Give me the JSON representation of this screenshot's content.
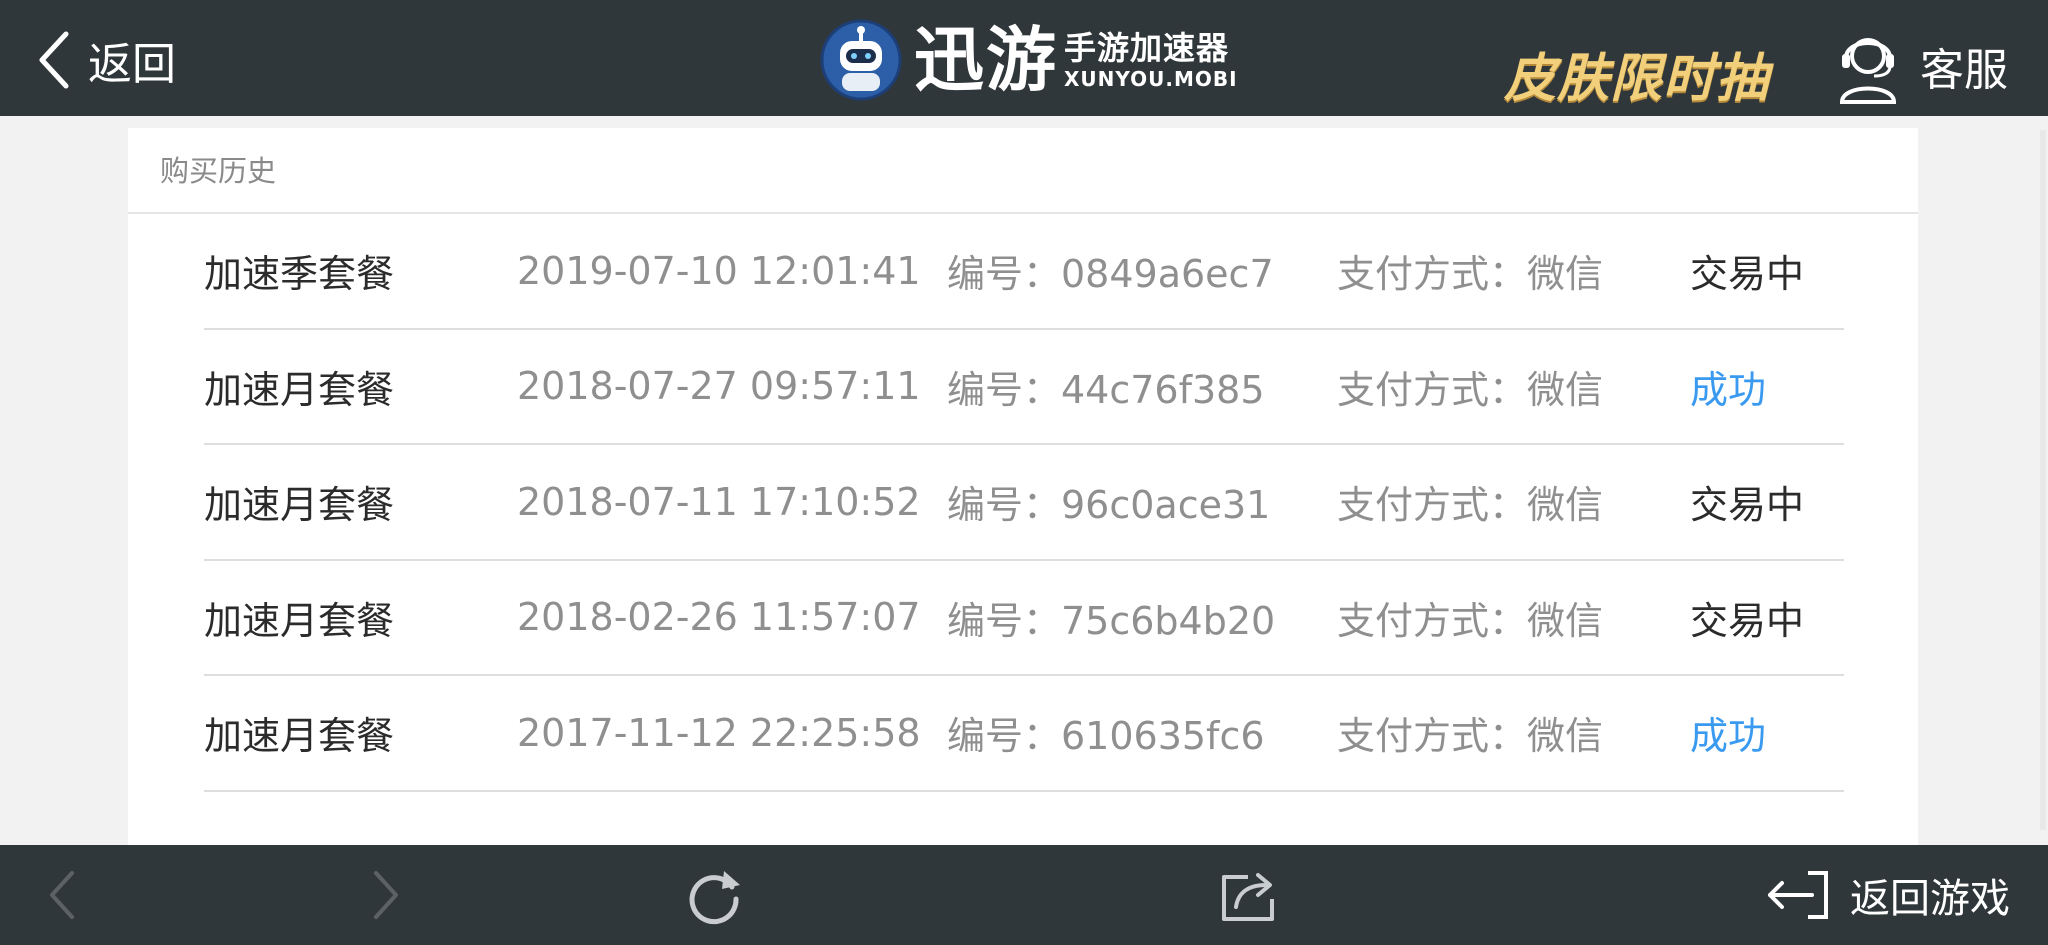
{
  "header": {
    "back_label": "返回",
    "brand_text": "迅游",
    "brand_sub_cn": "手游加速器",
    "brand_sub_en": "XUNYOU.MOBI",
    "promo_text": "皮肤限时抽",
    "support_label": "客服"
  },
  "section": {
    "title": "购买历史"
  },
  "orders": [
    {
      "plan": "加速季套餐",
      "time": "2019-07-10 12:01:41",
      "id": "编号：0849a6ec7",
      "pay": "支付方式：微信",
      "status": "交易中",
      "status_type": "pending"
    },
    {
      "plan": "加速月套餐",
      "time": "2018-07-27 09:57:11",
      "id": "编号：44c76f385",
      "pay": "支付方式：微信",
      "status": "成功",
      "status_type": "success"
    },
    {
      "plan": "加速月套餐",
      "time": "2018-07-11 17:10:52",
      "id": "编号：96c0ace31",
      "pay": "支付方式：微信",
      "status": "交易中",
      "status_type": "pending"
    },
    {
      "plan": "加速月套餐",
      "time": "2018-02-26 11:57:07",
      "id": "编号：75c6b4b20",
      "pay": "支付方式：微信",
      "status": "交易中",
      "status_type": "pending"
    },
    {
      "plan": "加速月套餐",
      "time": "2017-11-12 22:25:58",
      "id": "编号：610635fc6",
      "pay": "支付方式：微信",
      "status": "成功",
      "status_type": "success"
    }
  ],
  "bottom": {
    "return_game_label": "返回游戏",
    "icons": [
      "back-arrow-icon",
      "forward-arrow-icon",
      "refresh-icon",
      "share-icon",
      "exit-icon"
    ]
  },
  "colors": {
    "bar_bg": "#30373a",
    "success": "#3a9af0",
    "promo": "#f2cf7a"
  }
}
